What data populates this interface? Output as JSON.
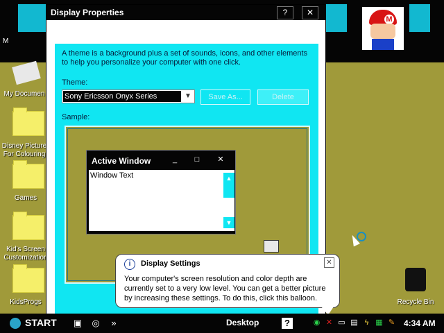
{
  "desktop": {
    "icons": [
      {
        "label": "My Documen"
      },
      {
        "label": "Disney Picture For Colouring"
      },
      {
        "label": "Games"
      },
      {
        "label": "Kid's Screen Customization"
      },
      {
        "label": "KidsProgs"
      },
      {
        "label": "Recycle Bin"
      }
    ],
    "partial_letter": "M"
  },
  "window": {
    "title": "Display Properties",
    "help_button": "?",
    "close_button": "✕",
    "description": "A theme is a background plus a set of sounds, icons, and other elements to help you personalize your computer with one click.",
    "theme_label": "Theme:",
    "theme_value": "Sony Ericsson Onyx Series",
    "save_as_button": "Save As...",
    "delete_button": "Delete",
    "sample_label": "Sample:"
  },
  "sample_window": {
    "title": "Active Window",
    "minimize": "_",
    "maximize": "□",
    "close": "✕",
    "body_text": "Window Text"
  },
  "balloon": {
    "title": "Display Settings",
    "body": "Your computer's screen resolution and color depth are currently set to a very low level. You can get a better picture by increasing these settings. To do this, click this balloon.",
    "close": "✕",
    "info_icon": "i"
  },
  "taskbar": {
    "start_label": "START",
    "desktop_label": "Desktop",
    "help_icon": "?",
    "time": "4:34 AM"
  },
  "colors": {
    "desktop": "#a09a3a",
    "panel": "#10e6f2",
    "chrome": "#050505"
  }
}
